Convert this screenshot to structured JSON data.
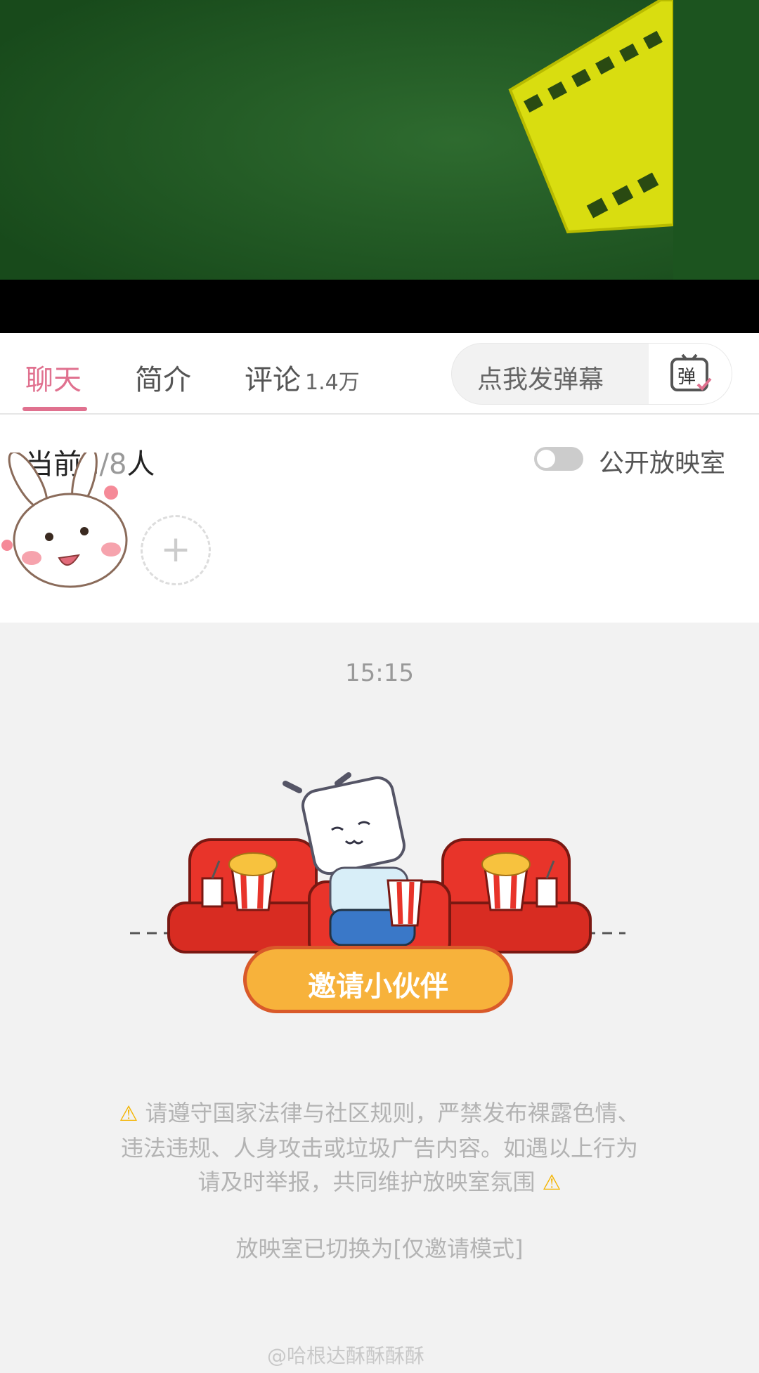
{
  "tabs": [
    {
      "label": "聊天",
      "count": ""
    },
    {
      "label": "简介",
      "count": ""
    },
    {
      "label": "评论",
      "count": "1.4万"
    }
  ],
  "danmaku": {
    "placeholder": "点我发弹幕",
    "button_icon": "danmaku-icon",
    "button_glyph": "弹"
  },
  "members": {
    "prefix": "当前",
    "current": "1",
    "max": "8",
    "unit": "人",
    "public_label": "公开放映室",
    "public_on": false,
    "add_glyph": "+"
  },
  "chat": {
    "time": "15:15",
    "invite_label": "邀请小伙伴",
    "notice_line1": "请遵守国家法律与社区规则，严禁发布裸露色情、",
    "notice_line2": "违法违规、人身攻击或垃圾广告内容。如遇以上行为",
    "notice_line3": "请及时举报，共同维护放映室氛围",
    "warning_glyph": "⚠",
    "mode": "放映室已切换为[仅邀请模式]"
  },
  "watermark": "@哈根达酥酥酥酥",
  "colors": {
    "accent": "#e0718f",
    "video_bg": "#1f5a22",
    "film": "#d4d400",
    "invite": "#f7b23b"
  }
}
